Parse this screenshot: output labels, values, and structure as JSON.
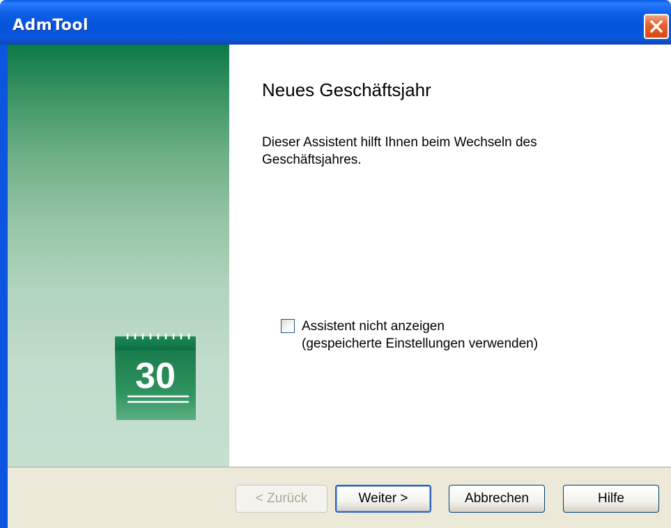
{
  "window": {
    "title": "AdmTool"
  },
  "wizard": {
    "heading": "Neues Geschäftsjahr",
    "description": "Dieser Assistent hilft Ihnen beim Wechseln des Geschäftsjahres.",
    "checkbox": {
      "label_line1": "Assistent nicht anzeigen",
      "label_line2": "(gespeicherte Einstellungen verwenden)",
      "checked": false
    },
    "side_icon": {
      "name": "calendar-icon",
      "text": "30"
    }
  },
  "buttons": {
    "back": "< Zurück",
    "next": "Weiter >",
    "cancel": "Abbrechen",
    "help": "Hilfe"
  },
  "colors": {
    "titlebar": "#0553db",
    "side_panel_top": "#0c7a47",
    "side_panel_bottom": "#c6e0d0",
    "footer": "#ece9d8",
    "close_button": "#e5622f"
  }
}
